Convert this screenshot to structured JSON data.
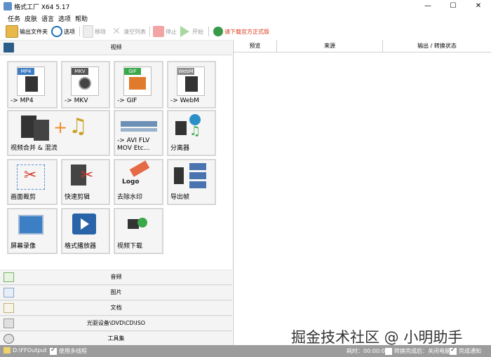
{
  "window": {
    "title": "格式工厂 X64 5.17",
    "minimize": "—",
    "maximize": "☐",
    "close": "✕"
  },
  "menu": [
    "任务",
    "皮肤",
    "语言",
    "选项",
    "帮助"
  ],
  "toolbar": {
    "output_folder": "输出文件夹",
    "options": "选项",
    "remove": "移除",
    "clear_list": "清空列表",
    "stop": "停止",
    "start": "开始",
    "download": "请下载官方正式版"
  },
  "sections": {
    "video": "视频",
    "audio": "音频",
    "image": "图片",
    "document": "文档",
    "disc": "光驱设备\\DVD\\CD\\ISO",
    "tools": "工具集"
  },
  "tiles": [
    {
      "label": "-> MP4",
      "badge": "MP4"
    },
    {
      "label": "-> MKV",
      "badge": "MKV"
    },
    {
      "label": "-> GIF",
      "badge": "GIF"
    },
    {
      "label": "-> WebM",
      "badge": "WebM"
    },
    {
      "label": "视频合并 & 混流"
    },
    {
      "label": "-> AVI FLV\nMOV Etc..."
    },
    {
      "label": "分离器"
    },
    {
      "label": "画面裁剪"
    },
    {
      "label": "快速剪辑"
    },
    {
      "label": "去除水印",
      "badge": "Logo"
    },
    {
      "label": "导出帧"
    },
    {
      "label": "屏幕录像"
    },
    {
      "label": "格式播放器"
    },
    {
      "label": "视频下载"
    }
  ],
  "task_columns": [
    "预览",
    "来源",
    "输出 / 转换状态"
  ],
  "watermark": "掘金技术社区 @ 小明助手",
  "status": {
    "output_path": "D:\\FFOutput",
    "multithread": "使用多线程",
    "elapsed_label": "耗时：",
    "elapsed": "00:00:00",
    "after_convert": "转换完成后：关闭电脑",
    "notify": "完成通知"
  },
  "colors": {
    "statusbar": "#9c9c9c",
    "tile_bg": "#f5f5f5",
    "tile_border": "#d7d7d7",
    "download_text": "#d9391a"
  }
}
